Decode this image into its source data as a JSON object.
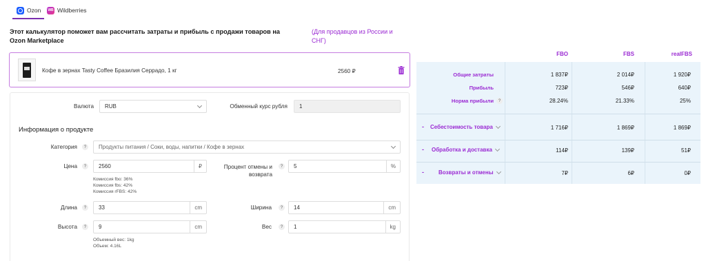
{
  "tabs": [
    {
      "label": "Ozon",
      "active": true
    },
    {
      "label": "Wildberries",
      "active": false
    }
  ],
  "headline": "Этот калькулятор поможет вам рассчитать затраты и прибыль с продажи товаров на Ozon Marketplace",
  "subnote": "(Для продавцов из России и СНГ)",
  "product": {
    "name": "Кофе в зернах Tasty Coffee Бразилия Серрадо, 1 кг",
    "price": "2560 ₽"
  },
  "form": {
    "currency_label": "Валюта",
    "currency_value": "RUB",
    "rate_label": "Обменный курс рубля",
    "rate_value": "1",
    "section_title": "Информация о продукте",
    "category_label": "Категория",
    "category_value": "Продукты питания / Соки, воды, напитки / Кофе в зернах",
    "price_label": "Цена",
    "price_value": "2560",
    "price_unit": "₽",
    "commissions": [
      "Комиссия fbo: 36%",
      "Комиссия fbs: 42%",
      "Комиссия rFBS: 42%"
    ],
    "cancel_label_1": "Процент отмены и",
    "cancel_label_2": "возврата",
    "cancel_value": "5",
    "cancel_unit": "%",
    "length_label": "Длина",
    "length_value": "33",
    "length_unit": "cm",
    "width_label": "Ширина",
    "width_value": "14",
    "width_unit": "cm",
    "height_label": "Высота",
    "height_value": "9",
    "height_unit": "cm",
    "weight_label": "Вес",
    "weight_value": "1",
    "weight_unit": "kg",
    "volume_notes": [
      "Объемный вес: 1kg",
      "Объем: 4.16L"
    ]
  },
  "results": {
    "columns": [
      "FBO",
      "FBS",
      "realFBS"
    ],
    "rows": [
      {
        "label": "Общие затраты",
        "values": [
          "1 837₽",
          "2 014₽",
          "1 920₽"
        ]
      },
      {
        "label": "Прибыль",
        "values": [
          "723₽",
          "546₽",
          "640₽"
        ]
      },
      {
        "label": "Норма прибыли",
        "values": [
          "28.24%",
          "21.33%",
          "25%"
        ]
      }
    ],
    "groups": [
      {
        "label": "Себестоимость товара",
        "values": [
          "1 716₽",
          "1 869₽",
          "1 869₽"
        ]
      },
      {
        "label": "Обработка и доставка",
        "values": [
          "114₽",
          "139₽",
          "51₽"
        ]
      },
      {
        "label": "Возвраты и отмены",
        "values": [
          "7₽",
          "6₽",
          "0₽"
        ]
      }
    ]
  },
  "colors": {
    "accent": "#9b2bd3",
    "ozon": "#1a5dff",
    "table_bg": "#eaf4fb"
  }
}
